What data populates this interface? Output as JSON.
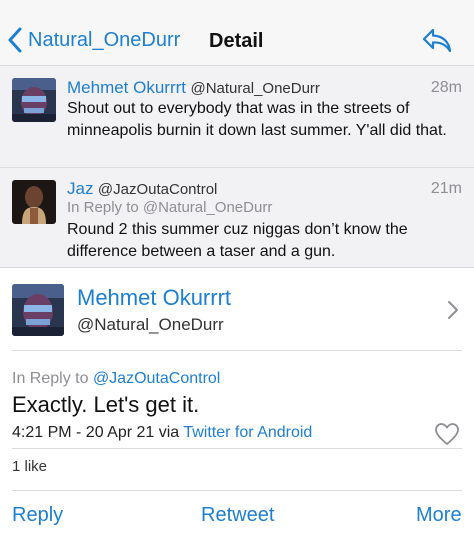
{
  "colors": {
    "accent": "#1d7fd1",
    "muted": "#8e8e93",
    "tweet_bg": "#f2f2f4"
  },
  "nav": {
    "back_icon": "chevron-left-icon",
    "back_label": "Natural_OneDurr",
    "title": "Detail",
    "reply_icon": "reply-arrow-icon"
  },
  "thread": [
    {
      "name": "Mehmet Okurrrt",
      "handle": "@Natural_OneDurr",
      "time": "28m",
      "text": "Shout out to everybody that was in the streets of minneapolis burnin it down last summer. Y'all did that."
    },
    {
      "name": "Jaz",
      "handle": "@JazOutaControl",
      "time": "21m",
      "in_reply": "In Reply to @Natural_OneDurr",
      "text": "Round 2 this summer cuz niggas don’t know the difference between a taser and a gun."
    }
  ],
  "detail": {
    "name": "Mehmet Okurrrt",
    "handle": "@Natural_OneDurr",
    "in_reply_prefix": "In Reply to",
    "in_reply_handle": "@JazOutaControl",
    "text": "Exactly. Let's get it.",
    "timestamp": "4:21 PM - 20 Apr 21 via",
    "client": "Twitter for Android",
    "likes": "1 like",
    "heart_icon": "heart-outline-icon"
  },
  "actions": {
    "reply": "Reply",
    "retweet": "Retweet",
    "more": "More"
  }
}
